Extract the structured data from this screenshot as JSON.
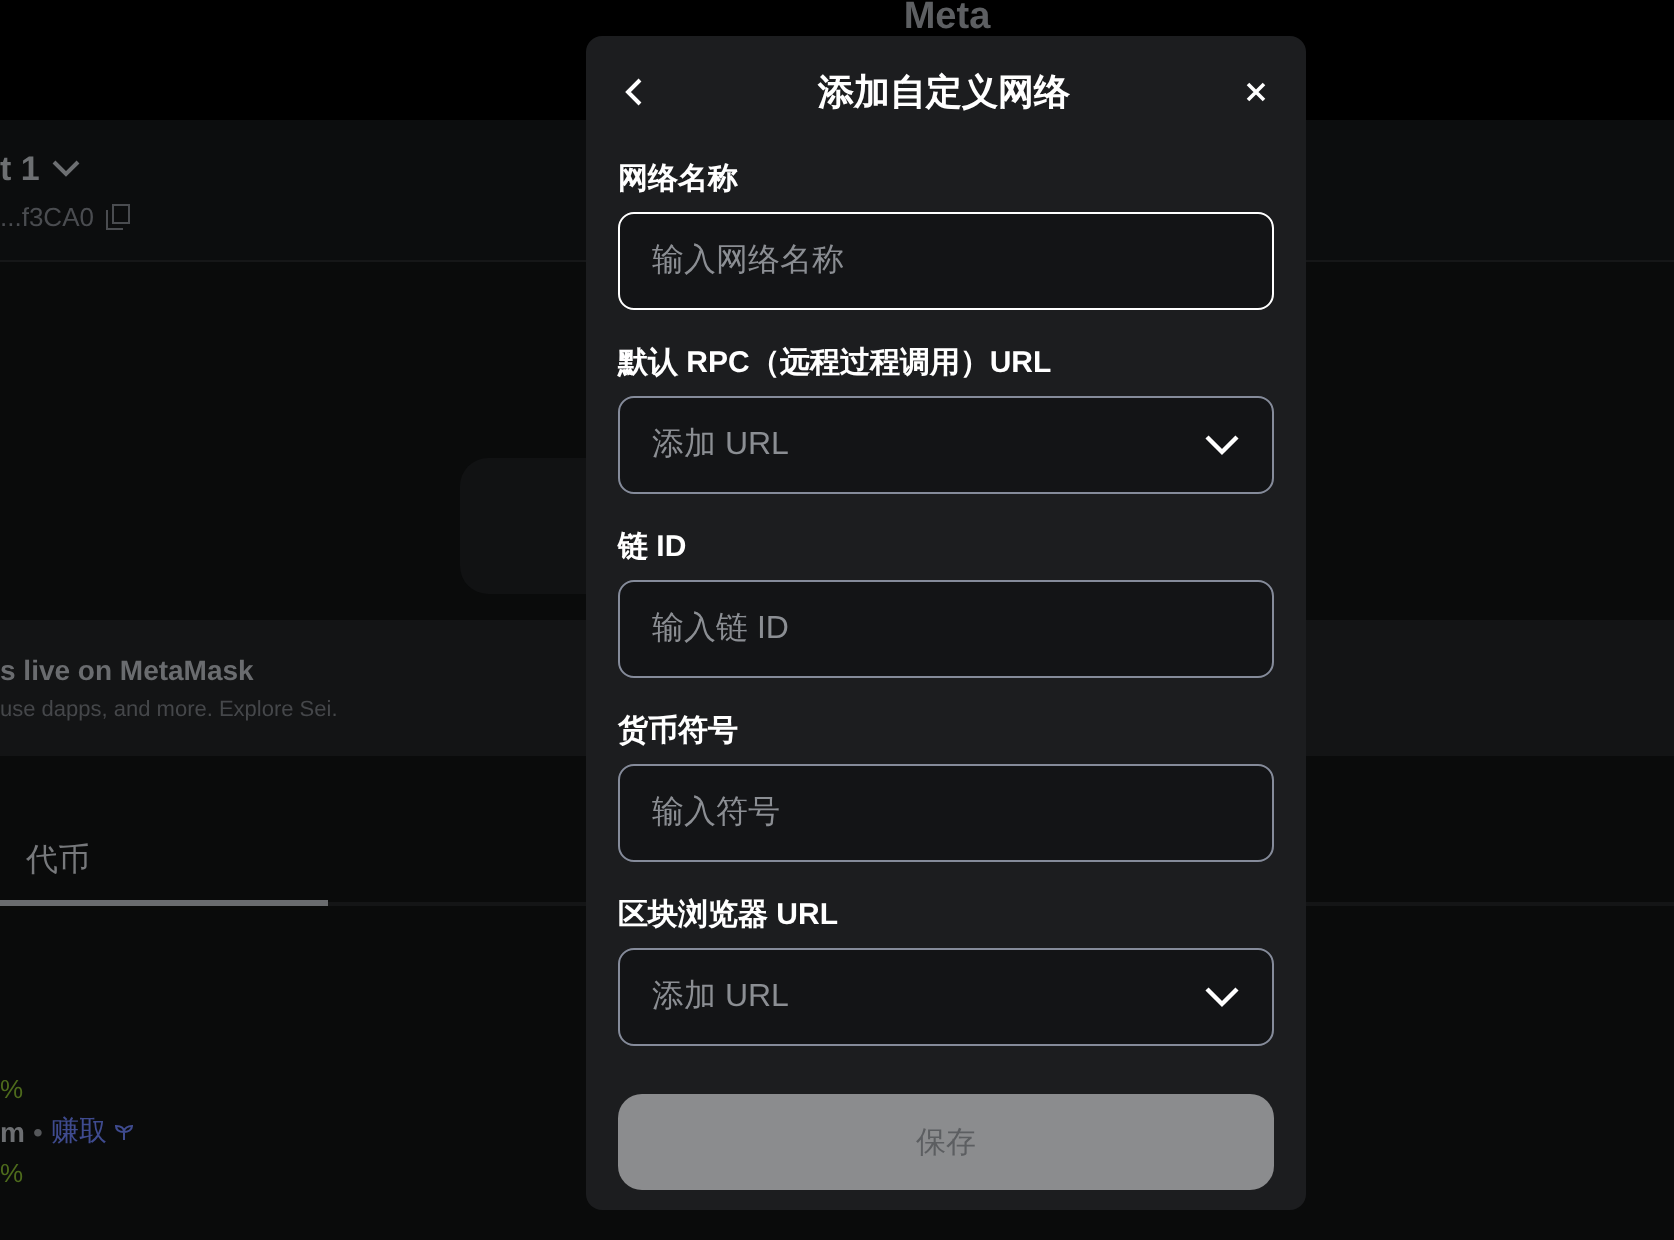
{
  "background": {
    "logo": "Meta",
    "account_name": "t 1",
    "account_address": "...f3CA0",
    "banner": {
      "title": "s live on MetaMask",
      "text": "use dapps, and more. Explore Sei."
    },
    "tabs": [
      {
        "label": "代币",
        "selected": true
      }
    ],
    "rows": [
      {
        "kind": "change",
        "text": "%"
      },
      {
        "kind": "name",
        "text": "m",
        "separator": "•",
        "link": "赚取"
      },
      {
        "kind": "change",
        "text": "%"
      }
    ]
  },
  "modal": {
    "title": "添加自定义网络",
    "fields": [
      {
        "label": "网络名称",
        "kind": "text",
        "placeholder": "输入网络名称",
        "focused": true
      },
      {
        "label": "默认 RPC（远程过程调用）URL",
        "kind": "dropdown",
        "placeholder": "添加 URL",
        "focused": false
      },
      {
        "label": "链 ID",
        "kind": "text",
        "placeholder": "输入链 ID",
        "focused": false
      },
      {
        "label": "货币符号",
        "kind": "text",
        "placeholder": "输入符号",
        "focused": false
      },
      {
        "label": "区块浏览器 URL",
        "kind": "dropdown",
        "placeholder": "添加 URL",
        "focused": false
      }
    ],
    "save_button": {
      "label": "保存",
      "disabled": true
    }
  }
}
